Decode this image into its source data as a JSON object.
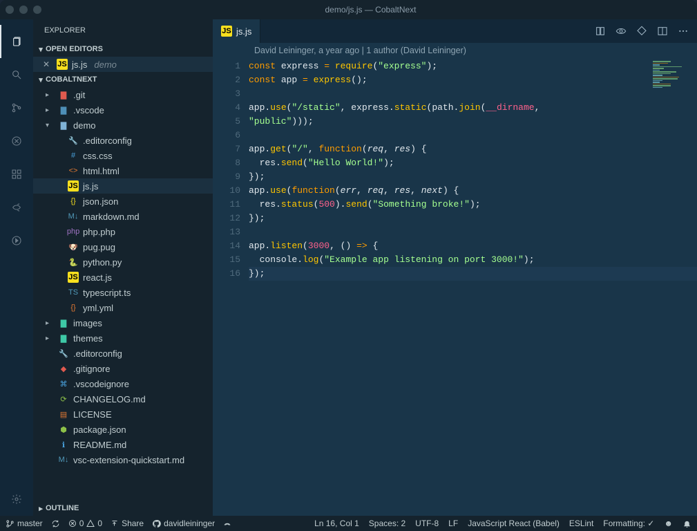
{
  "window": {
    "title": "demo/js.js — CobaltNext"
  },
  "sidebar": {
    "title": "EXPLORER",
    "sections": {
      "openEditors": {
        "label": "OPEN EDITORS"
      },
      "project": {
        "label": "COBALTNEXT"
      },
      "outline": {
        "label": "OUTLINE"
      }
    },
    "openEditor": {
      "filename": "js.js",
      "folder": "demo"
    }
  },
  "tree": [
    {
      "depth": 0,
      "kind": "folder",
      "name": ".git",
      "expanded": false,
      "color": "#e05a4f"
    },
    {
      "depth": 0,
      "kind": "folder",
      "name": ".vscode",
      "expanded": false,
      "color": "#4e8fb7"
    },
    {
      "depth": 0,
      "kind": "folder",
      "name": "demo",
      "expanded": true,
      "color": "#7fb2d6"
    },
    {
      "depth": 1,
      "kind": "file",
      "name": ".editorconfig",
      "icon": "wrench",
      "color": "#c1cdd0"
    },
    {
      "depth": 1,
      "kind": "file",
      "name": "css.css",
      "icon": "css",
      "color": "#4aa3df"
    },
    {
      "depth": 1,
      "kind": "file",
      "name": "html.html",
      "icon": "html",
      "color": "#e37933"
    },
    {
      "depth": 1,
      "kind": "file",
      "name": "js.js",
      "icon": "js",
      "color": "#f7df1e",
      "active": true
    },
    {
      "depth": 1,
      "kind": "file",
      "name": "json.json",
      "icon": "json",
      "color": "#f7df1e"
    },
    {
      "depth": 1,
      "kind": "file",
      "name": "markdown.md",
      "icon": "md",
      "color": "#519aba"
    },
    {
      "depth": 1,
      "kind": "file",
      "name": "php.php",
      "icon": "php",
      "color": "#a074c4"
    },
    {
      "depth": 1,
      "kind": "file",
      "name": "pug.pug",
      "icon": "pug",
      "color": "#c1a78b"
    },
    {
      "depth": 1,
      "kind": "file",
      "name": "python.py",
      "icon": "py",
      "color": "#4584b6"
    },
    {
      "depth": 1,
      "kind": "file",
      "name": "react.js",
      "icon": "js",
      "color": "#f7df1e"
    },
    {
      "depth": 1,
      "kind": "file",
      "name": "typescript.ts",
      "icon": "ts",
      "color": "#519aba"
    },
    {
      "depth": 1,
      "kind": "file",
      "name": "yml.yml",
      "icon": "yml",
      "color": "#e37933"
    },
    {
      "depth": 0,
      "kind": "folder",
      "name": "images",
      "expanded": false,
      "color": "#3ec9a7"
    },
    {
      "depth": 0,
      "kind": "folder",
      "name": "themes",
      "expanded": false,
      "color": "#3ec9a7"
    },
    {
      "depth": 0,
      "kind": "file",
      "name": ".editorconfig",
      "icon": "wrench",
      "color": "#c1cdd0"
    },
    {
      "depth": 0,
      "kind": "file",
      "name": ".gitignore",
      "icon": "git",
      "color": "#e05a4f"
    },
    {
      "depth": 0,
      "kind": "file",
      "name": ".vscodeignore",
      "icon": "vscode",
      "color": "#4aa3df"
    },
    {
      "depth": 0,
      "kind": "file",
      "name": "CHANGELOG.md",
      "icon": "changelog",
      "color": "#8dc149"
    },
    {
      "depth": 0,
      "kind": "file",
      "name": "LICENSE",
      "icon": "license",
      "color": "#e37933"
    },
    {
      "depth": 0,
      "kind": "file",
      "name": "package.json",
      "icon": "npm",
      "color": "#8dc149"
    },
    {
      "depth": 0,
      "kind": "file",
      "name": "README.md",
      "icon": "info",
      "color": "#4aa3df"
    },
    {
      "depth": 0,
      "kind": "file",
      "name": "vsc-extension-quickstart.md",
      "icon": "md",
      "color": "#519aba"
    }
  ],
  "tab": {
    "filename": "js.js"
  },
  "codelens": "David Leininger, a year ago | 1 author (David Leininger)",
  "code": {
    "lines": [
      [
        {
          "t": "const ",
          "c": "kw"
        },
        {
          "t": "express",
          "c": "var"
        },
        {
          "t": " = ",
          "c": "op"
        },
        {
          "t": "require",
          "c": "fn"
        },
        {
          "t": "(",
          "c": "punc"
        },
        {
          "t": "\"express\"",
          "c": "str"
        },
        {
          "t": ")",
          "c": "punc"
        },
        {
          "t": ";",
          "c": "punc"
        }
      ],
      [
        {
          "t": "const ",
          "c": "kw"
        },
        {
          "t": "app",
          "c": "var"
        },
        {
          "t": " = ",
          "c": "op"
        },
        {
          "t": "express",
          "c": "fn"
        },
        {
          "t": "()",
          "c": "punc"
        },
        {
          "t": ";",
          "c": "punc"
        }
      ],
      [],
      [
        {
          "t": "app",
          "c": "var"
        },
        {
          "t": ".",
          "c": "punc"
        },
        {
          "t": "use",
          "c": "fn"
        },
        {
          "t": "(",
          "c": "punc"
        },
        {
          "t": "\"/static\"",
          "c": "str"
        },
        {
          "t": ", ",
          "c": "punc"
        },
        {
          "t": "express",
          "c": "var"
        },
        {
          "t": ".",
          "c": "punc"
        },
        {
          "t": "static",
          "c": "fn"
        },
        {
          "t": "(",
          "c": "punc"
        },
        {
          "t": "path",
          "c": "var"
        },
        {
          "t": ".",
          "c": "punc"
        },
        {
          "t": "join",
          "c": "fn"
        },
        {
          "t": "(",
          "c": "punc"
        },
        {
          "t": "__dirname",
          "c": "const"
        },
        {
          "t": ",",
          "c": "punc"
        }
      ],
      [
        {
          "t": "\"public\"",
          "c": "str"
        },
        {
          "t": ")))",
          "c": "punc"
        },
        {
          "t": ";",
          "c": "punc"
        }
      ],
      [],
      [
        {
          "t": "app",
          "c": "var"
        },
        {
          "t": ".",
          "c": "punc"
        },
        {
          "t": "get",
          "c": "fn"
        },
        {
          "t": "(",
          "c": "punc"
        },
        {
          "t": "\"/\"",
          "c": "str"
        },
        {
          "t": ", ",
          "c": "punc"
        },
        {
          "t": "function",
          "c": "kw"
        },
        {
          "t": "(",
          "c": "punc"
        },
        {
          "t": "req",
          "c": "param"
        },
        {
          "t": ", ",
          "c": "punc"
        },
        {
          "t": "res",
          "c": "param"
        },
        {
          "t": ") {",
          "c": "punc"
        }
      ],
      [
        {
          "t": "  ",
          "c": "punc"
        },
        {
          "t": "res",
          "c": "var"
        },
        {
          "t": ".",
          "c": "punc"
        },
        {
          "t": "send",
          "c": "fn"
        },
        {
          "t": "(",
          "c": "punc"
        },
        {
          "t": "\"Hello World!\"",
          "c": "str"
        },
        {
          "t": ")",
          "c": "punc"
        },
        {
          "t": ";",
          "c": "punc"
        }
      ],
      [
        {
          "t": "})",
          "c": "punc"
        },
        {
          "t": ";",
          "c": "punc"
        }
      ],
      [
        {
          "t": "app",
          "c": "var"
        },
        {
          "t": ".",
          "c": "punc"
        },
        {
          "t": "use",
          "c": "fn"
        },
        {
          "t": "(",
          "c": "punc"
        },
        {
          "t": "function",
          "c": "kw"
        },
        {
          "t": "(",
          "c": "punc"
        },
        {
          "t": "err",
          "c": "param"
        },
        {
          "t": ", ",
          "c": "punc"
        },
        {
          "t": "req",
          "c": "param"
        },
        {
          "t": ", ",
          "c": "punc"
        },
        {
          "t": "res",
          "c": "param"
        },
        {
          "t": ", ",
          "c": "punc"
        },
        {
          "t": "next",
          "c": "param"
        },
        {
          "t": ") {",
          "c": "punc"
        }
      ],
      [
        {
          "t": "  ",
          "c": "punc"
        },
        {
          "t": "res",
          "c": "var"
        },
        {
          "t": ".",
          "c": "punc"
        },
        {
          "t": "status",
          "c": "fn"
        },
        {
          "t": "(",
          "c": "punc"
        },
        {
          "t": "500",
          "c": "num"
        },
        {
          "t": ")",
          "c": "punc"
        },
        {
          "t": ".",
          "c": "punc"
        },
        {
          "t": "send",
          "c": "fn"
        },
        {
          "t": "(",
          "c": "punc"
        },
        {
          "t": "\"Something broke!\"",
          "c": "str"
        },
        {
          "t": ")",
          "c": "punc"
        },
        {
          "t": ";",
          "c": "punc"
        }
      ],
      [
        {
          "t": "})",
          "c": "punc"
        },
        {
          "t": ";",
          "c": "punc"
        }
      ],
      [],
      [
        {
          "t": "app",
          "c": "var"
        },
        {
          "t": ".",
          "c": "punc"
        },
        {
          "t": "listen",
          "c": "fn"
        },
        {
          "t": "(",
          "c": "punc"
        },
        {
          "t": "3000",
          "c": "num"
        },
        {
          "t": ", () ",
          "c": "punc"
        },
        {
          "t": "=>",
          "c": "kw"
        },
        {
          "t": " {",
          "c": "punc"
        }
      ],
      [
        {
          "t": "  ",
          "c": "punc"
        },
        {
          "t": "console",
          "c": "var"
        },
        {
          "t": ".",
          "c": "punc"
        },
        {
          "t": "log",
          "c": "fn"
        },
        {
          "t": "(",
          "c": "punc"
        },
        {
          "t": "\"Example app listening on port 3000!\"",
          "c": "str"
        },
        {
          "t": ")",
          "c": "punc"
        },
        {
          "t": ";",
          "c": "punc"
        }
      ],
      [
        {
          "t": "})",
          "c": "punc"
        },
        {
          "t": ";",
          "c": "punc"
        }
      ]
    ],
    "currentLine": 16
  },
  "status": {
    "branch": "master",
    "errors": "0",
    "warnings": "0",
    "share": "Share",
    "github": "davidleininger",
    "position": "Ln 16, Col 1",
    "spaces": "Spaces: 2",
    "encoding": "UTF-8",
    "eol": "LF",
    "language": "JavaScript React (Babel)",
    "linter": "ESLint",
    "formatting": "Formatting: ✓"
  }
}
